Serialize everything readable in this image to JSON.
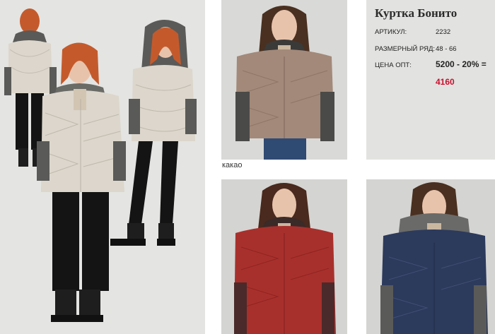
{
  "product": {
    "title": "Куртка Бонито",
    "article_label": "АРТИКУЛ:",
    "article_value": "2232",
    "size_label": "РАЗМЕРНЫЙ РЯД:",
    "size_value": "48 - 66",
    "price_label": "ЦЕНА ОПТ:",
    "price_formula": "5200 - 20% =",
    "price_final": "4160"
  },
  "photos": {
    "cocoa_caption": "какао"
  },
  "colors": {
    "price_accent": "#c8102e",
    "beige_jacket": "#dcd6cc",
    "cocoa_jacket": "#a3897a",
    "red_jacket": "#a8302c",
    "navy_jacket": "#2c3a5c",
    "knit_gray": "#5a5a58"
  }
}
